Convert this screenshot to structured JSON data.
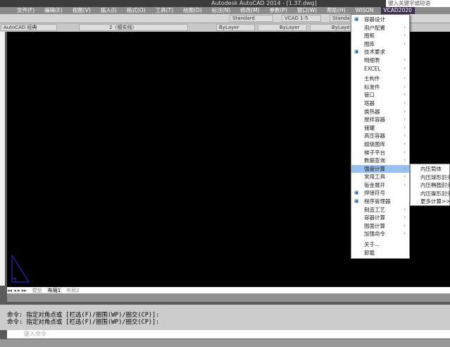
{
  "title": "Autodesk AutoCAD 2014 - [1.37.dwg]",
  "search_placeholder": "键入关键字或短语",
  "menubar": [
    "文件(F)",
    "编辑(E)",
    "视图(V)",
    "插入(I)",
    "格式(O)",
    "工具(T)",
    "绘图(D)",
    "标注(N)",
    "修改(M)",
    "参数(P)",
    "窗口(W)",
    "帮助(H)",
    "WISON",
    "VCAD2020"
  ],
  "toolbar": {
    "workspace": "AutoCAD 经典",
    "layer": "2（细实线）",
    "text_style": "Standard",
    "dim_style": "VCAD 1-5",
    "table_style": "Standard",
    "color": "ByLayer",
    "linetype": "ByLayer",
    "lineweight": "ByLayer"
  },
  "tabs": [
    "模型",
    "布局1",
    "布局2"
  ],
  "command": {
    "lines": [
      "命令: 指定对角点或 [栏选(F)/圈围(WP)/圈交(CP)]:",
      "命令: 指定对角点或 [栏选(F)/圈围(WP)/圈交(CP)]:"
    ],
    "placeholder": "键入命令"
  },
  "menu": {
    "items": [
      {
        "label": "容器设计",
        "submenu": false,
        "icon": "vessel-icon"
      },
      {
        "label": "用户配置",
        "submenu": true
      },
      {
        "label": "图框",
        "submenu": true
      },
      {
        "label": "图库",
        "submenu": true
      },
      {
        "label": "技术要求",
        "submenu": false,
        "icon": "text-icon"
      },
      {
        "label": "明细表",
        "submenu": true
      },
      {
        "label": "EXCEL",
        "submenu": true
      },
      {
        "sep": true
      },
      {
        "label": "主构件",
        "submenu": true
      },
      {
        "label": "标准件",
        "submenu": true
      },
      {
        "label": "管口",
        "submenu": true
      },
      {
        "label": "塔器",
        "submenu": true
      },
      {
        "label": "换热器",
        "submenu": true
      },
      {
        "label": "搅拌容器",
        "submenu": true
      },
      {
        "label": "储罐",
        "submenu": true
      },
      {
        "label": "高压容器",
        "submenu": true
      },
      {
        "label": "超级图库",
        "submenu": true
      },
      {
        "label": "梯子平台",
        "submenu": true
      },
      {
        "label": "数据查询",
        "submenu": true
      },
      {
        "label": "强度计算",
        "submenu": true,
        "selected": true
      },
      {
        "label": "常用工具",
        "submenu": true
      },
      {
        "label": "钣金展开",
        "submenu": true
      },
      {
        "label": "焊接符号",
        "submenu": false,
        "icon": "weld-icon"
      },
      {
        "label": "程序管理器",
        "submenu": false,
        "icon": "manager-icon"
      },
      {
        "label": "制造工艺",
        "submenu": true
      },
      {
        "label": "容器计算",
        "submenu": true
      },
      {
        "label": "图面计算",
        "submenu": true
      },
      {
        "label": "加强命令",
        "submenu": true
      },
      {
        "sep": true
      },
      {
        "label": "关于...",
        "submenu": false
      },
      {
        "label": "卸载",
        "submenu": false
      }
    ]
  },
  "submenu": [
    "内压筒体",
    "内压球形封头",
    "内压椭圆封头",
    "内压碟形封头",
    "更多计算>>"
  ]
}
